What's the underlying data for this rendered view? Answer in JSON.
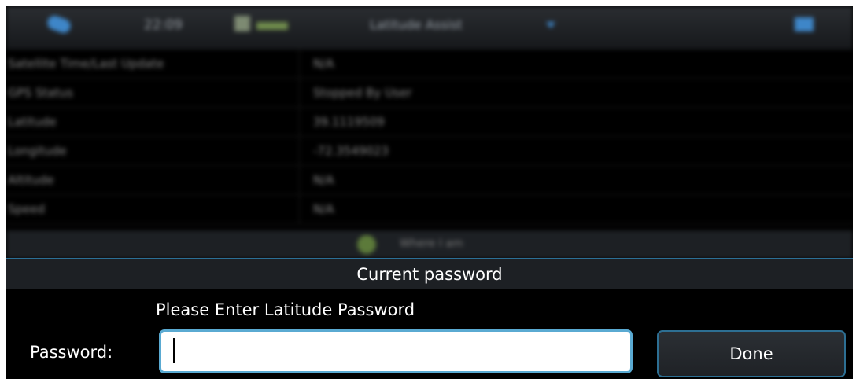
{
  "background_app": {
    "status_bar": {
      "time": "22:09",
      "title": "Latitude Assist"
    },
    "info_rows": [
      {
        "label": "Satellite Time/Last Update",
        "value": "N/A"
      },
      {
        "label": "GPS Status",
        "value": "Stopped By User"
      },
      {
        "label": "Latitude",
        "value": "39.1119509"
      },
      {
        "label": "Longitude",
        "value": "-72.3549023"
      },
      {
        "label": "Altitude",
        "value": "N/A"
      },
      {
        "label": "Speed",
        "value": "N/A"
      }
    ],
    "where_button_label": "Where I am"
  },
  "dialog": {
    "title": "Current password",
    "prompt": "Please Enter Latitude Password",
    "password_label": "Password:",
    "password_value": "",
    "done_label": "Done"
  },
  "colors": {
    "accent": "#5aaad2",
    "done_border": "#2d6f93",
    "dialog_background": "#000000"
  }
}
